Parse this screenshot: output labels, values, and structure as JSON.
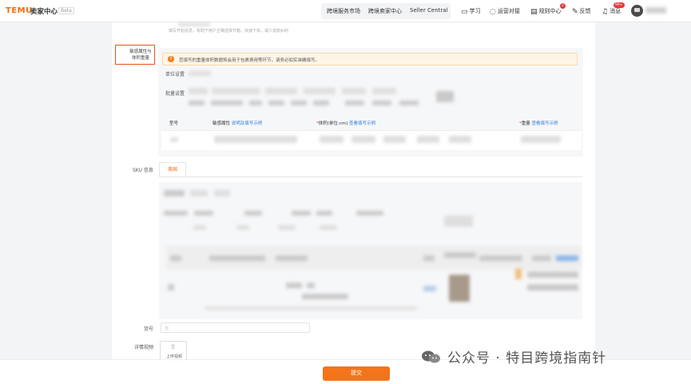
{
  "topbar": {
    "logo": "TEMU",
    "logo_sub": "卖家中心",
    "beta": "Beta",
    "nav": [
      "跨境服务市场",
      "跨境卖家中心",
      "Seller Central"
    ],
    "tools": [
      {
        "icon": "book-icon",
        "label": "学习"
      },
      {
        "icon": "chat-icon",
        "label": "运营对接"
      },
      {
        "icon": "document-icon",
        "label": "规则中心",
        "badge": "2"
      },
      {
        "icon": "feedback-icon",
        "label": "反馈"
      },
      {
        "icon": "bell-icon",
        "label": "消息",
        "badge": "99+"
      }
    ]
  },
  "form": {
    "top_hint": "填写开始信息，有助于用户正确选择开箱，快速下单，减少退款纠纷",
    "attr_label": "敏感属性与体积重量",
    "alert": "您填写的重量体积数据将会用于包裹费用等环节，请务必如实准确填写。",
    "row_labels": [
      "单位设置",
      "批量设置"
    ],
    "table_headers": [
      {
        "label": "型号",
        "link": "",
        "required": false
      },
      {
        "label": "敏感属性",
        "link": "说明及填写示例",
        "required": false
      },
      {
        "label": "体积(单位:cm)",
        "link": "查看填写示例",
        "required": true
      },
      {
        "label": "重量",
        "link": "查看填写示例",
        "required": true
      }
    ],
    "sku_label": "SKU 信息",
    "sku_tab": "美国",
    "model_label": "货号",
    "model_placeholder": "无",
    "video_label": "详情视频",
    "upload_label": "上传视频",
    "upload_icon": "upload-icon",
    "submit": "提交"
  },
  "watermark": {
    "text": "公众号 · 特目跨境指南针",
    "icon": "wechat-icon"
  }
}
